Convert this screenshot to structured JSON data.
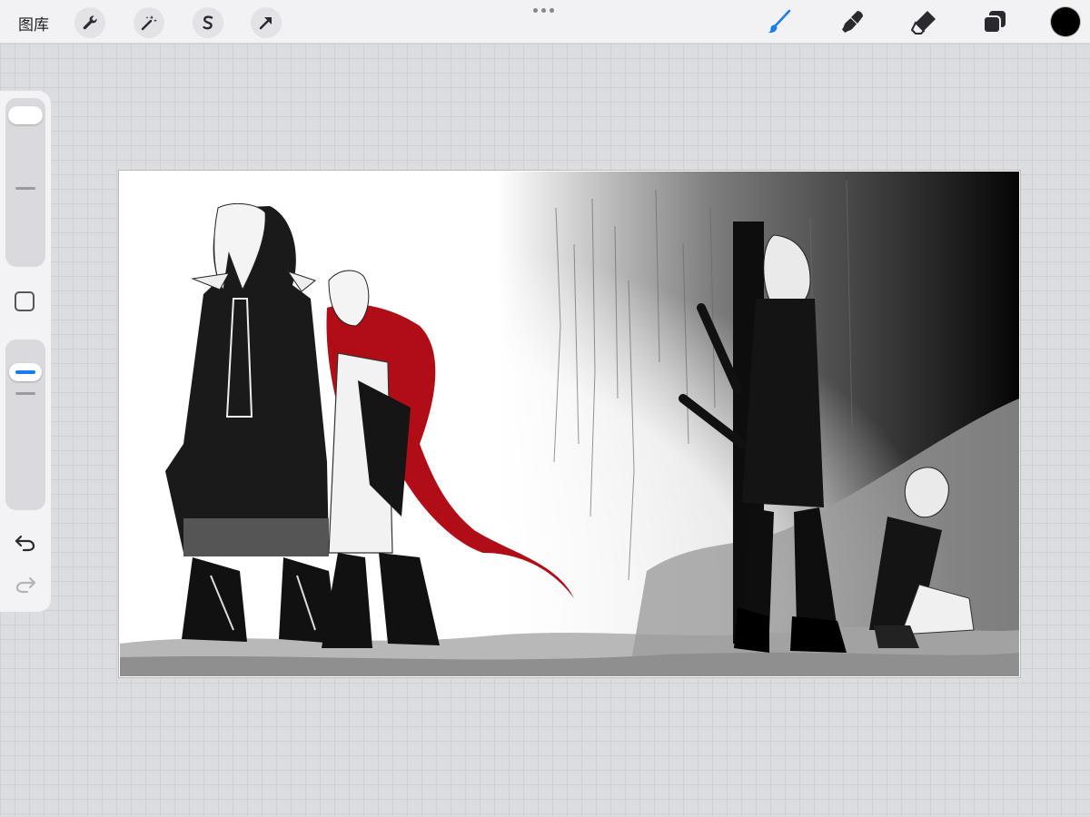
{
  "toolbar": {
    "gallery_label": "图库",
    "left_icons": [
      "wrench-icon",
      "magic-wand-icon",
      "selection-s-icon",
      "transform-arrow-icon"
    ],
    "right_tools": [
      "brush-icon",
      "smudge-icon",
      "eraser-icon",
      "layers-icon"
    ],
    "active_tool": "brush-icon",
    "active_tool_color": "#1a7cf5",
    "current_color": "#000000"
  },
  "sidebar": {
    "brush_size_icon": "size-slider",
    "modifier_icon": "square-modifier-icon",
    "undo_icon": "undo-arrow-icon",
    "redo_icon": "redo-arrow-icon",
    "redo_enabled": false
  },
  "canvas": {
    "accent_color": "#b00d16",
    "background_colors": [
      "#ffffff",
      "#000000"
    ]
  }
}
